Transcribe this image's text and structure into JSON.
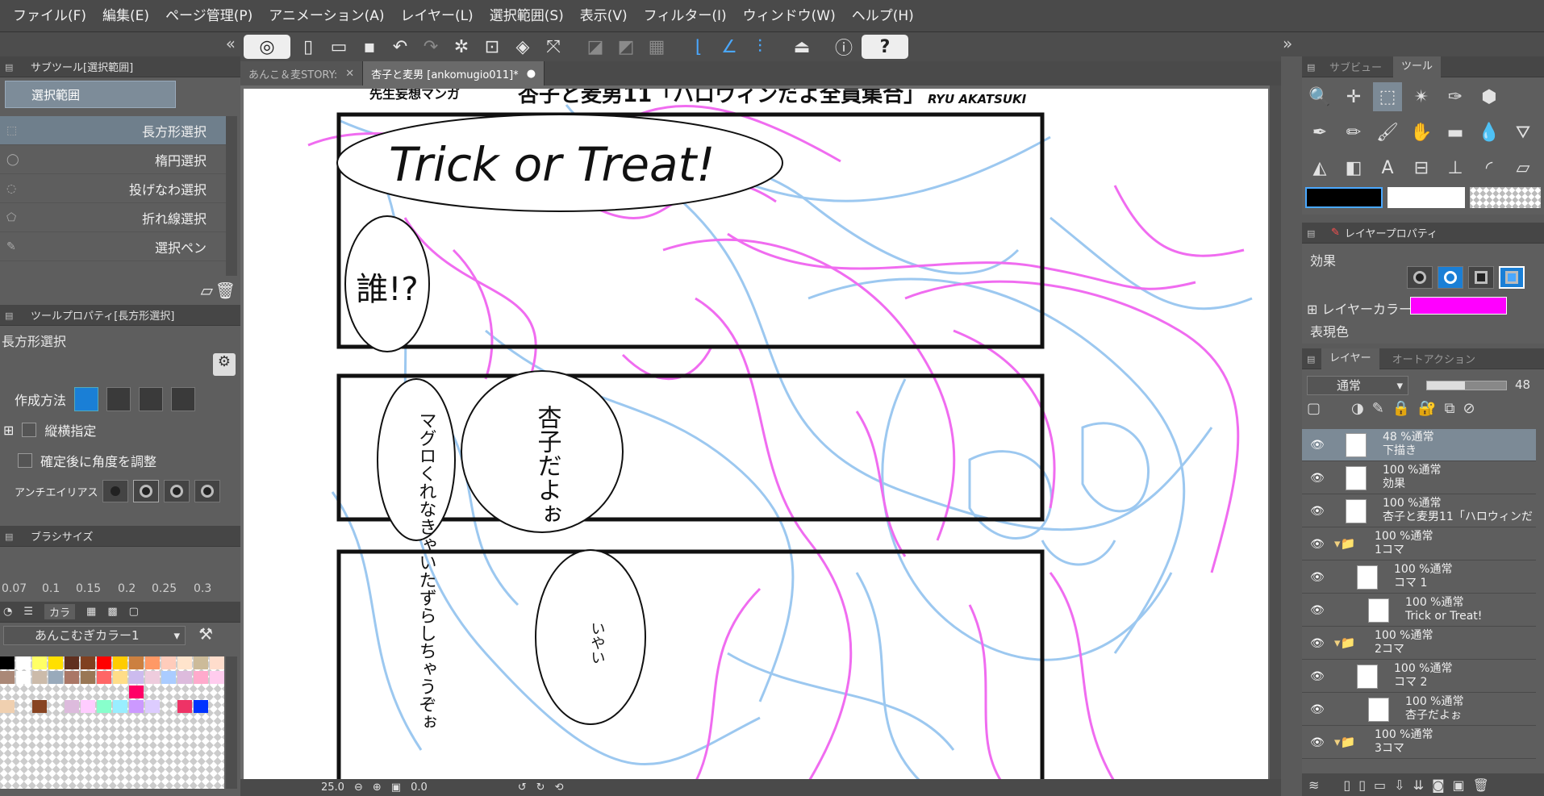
{
  "menu": [
    "ファイル(F)",
    "編集(E)",
    "ページ管理(P)",
    "アニメーション(A)",
    "レイヤー(L)",
    "選択範囲(S)",
    "表示(V)",
    "フィルター(I)",
    "ウィンドウ(W)",
    "ヘルプ(H)"
  ],
  "subtool": {
    "title": "サブツール[選択範囲]",
    "category": "選択範囲",
    "items": [
      "長方形選択",
      "楕円選択",
      "投げなわ選択",
      "折れ線選択",
      "選択ペン"
    ]
  },
  "toolprop": {
    "title": "ツールプロパティ[長方形選択]",
    "name": "長方形選択",
    "method_label": "作成方法",
    "aspect_label": "縦横指定",
    "angle_label": "確定後に角度を調整",
    "aa_label": "アンチエイリアス"
  },
  "brushsize": {
    "title": "ブラシサイズ",
    "values": [
      "0.07",
      "0.1",
      "0.15",
      "0.2",
      "0.25",
      "0.3"
    ]
  },
  "colorset": {
    "tab_label": "カラ",
    "set_name": "あんこむぎカラー1"
  },
  "tabs": [
    {
      "label": "あんこ＆麦STORY:"
    },
    {
      "label": "杏子と麦男 [ankomugio011]*"
    }
  ],
  "page": {
    "top_left": "先生妄想マンガ",
    "top_title": "杏子と麦男11「ハロウィンだよ全員集合」",
    "author": "RYU AKATSUKI",
    "balloon_1": "Trick or Treat!",
    "balloon_2": "誰!?",
    "balloon_3": "マグロくれなきゃいたずらしちゃうぞぉ",
    "balloon_4": "杏子だよぉ",
    "balloon_5": "いやい"
  },
  "status": {
    "zoom": "25.0",
    "angle": "0.0"
  },
  "right": {
    "subview_tab": "サブビュー",
    "tool_tab": "ツール",
    "layerprop_title": "レイヤープロパティ",
    "effect_label": "効果",
    "layer_color_label": "レイヤーカラー",
    "expression_label": "表現色",
    "layer_tab": "レイヤー",
    "autoaction_tab": "オートアクション",
    "blend_mode": "通常",
    "opacity": "48",
    "colors": {
      "main": "#000000",
      "sub": "#ffffff",
      "layer_color": "#ff00ff"
    }
  },
  "layers": [
    {
      "line1": "48 %通常",
      "line2": "下描き",
      "selected": true
    },
    {
      "line1": "100 %通常",
      "line2": "効果"
    },
    {
      "line1": "100 %通常",
      "line2": "杏子と麦男11「ハロウィンだ"
    },
    {
      "line1": "100 %通常",
      "line2": "1コマ"
    },
    {
      "line1": "100 %通常",
      "line2": "コマ 1"
    },
    {
      "line1": "100 %通常",
      "line2": "Trick or Treat!"
    },
    {
      "line1": "100 %通常",
      "line2": "2コマ"
    },
    {
      "line1": "100 %通常",
      "line2": "コマ 2"
    },
    {
      "line1": "100 %通常",
      "line2": "杏子だよぉ"
    },
    {
      "line1": "100 %通常",
      "line2": "3コマ"
    }
  ]
}
